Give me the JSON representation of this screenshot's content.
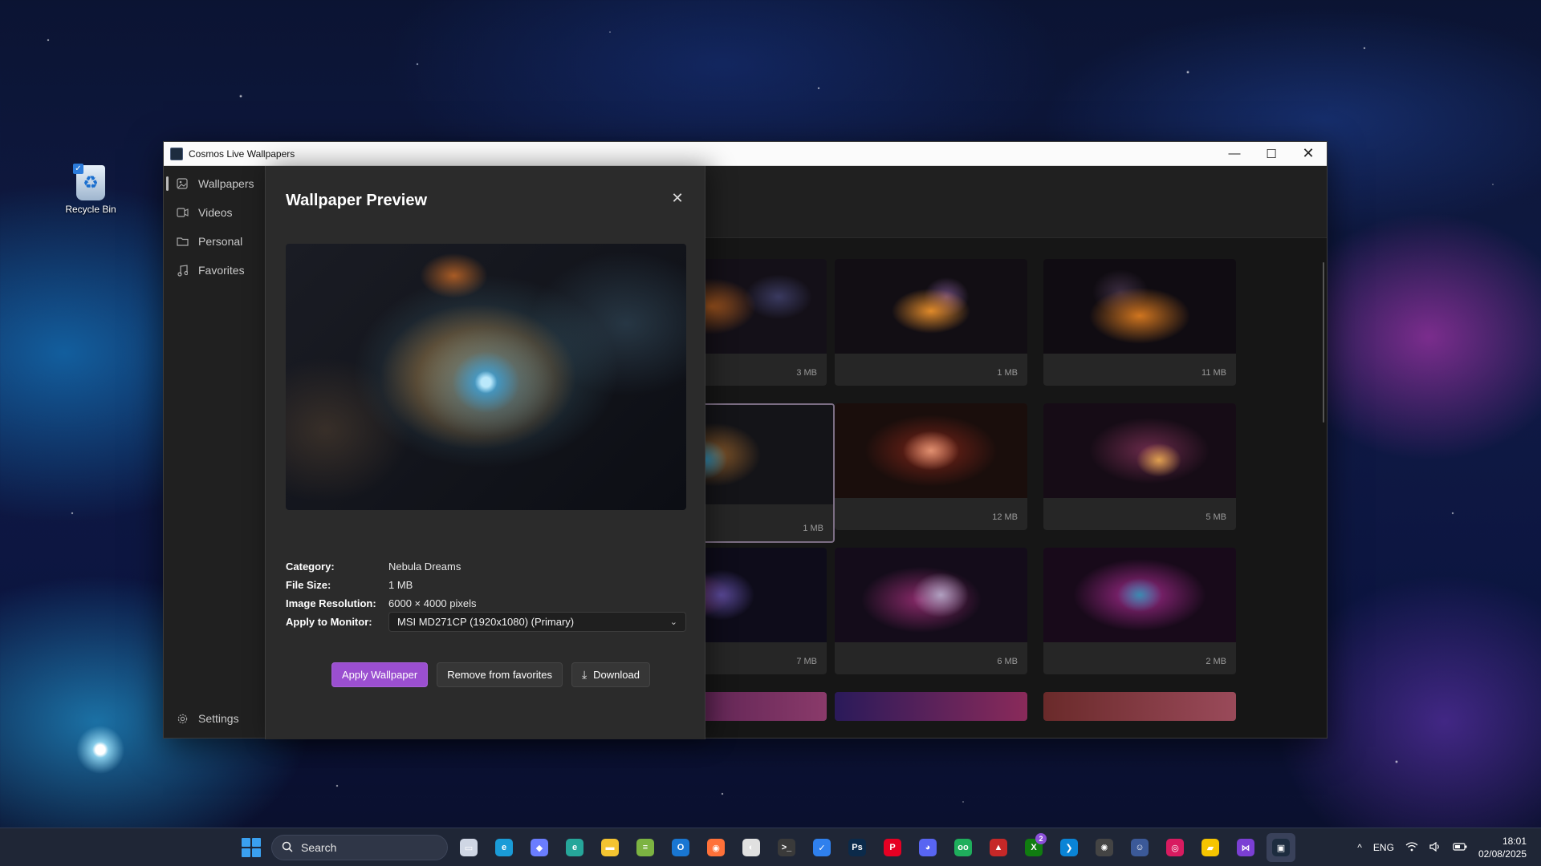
{
  "desktop": {
    "icons": [
      {
        "label": "Recycle Bin"
      }
    ]
  },
  "window": {
    "title": "Cosmos Live Wallpapers",
    "controls": {
      "minimize": "—",
      "maximize": "☐",
      "close": "✕"
    }
  },
  "nav": {
    "items": [
      {
        "label": "Wallpapers",
        "icon": "image-icon",
        "active": true
      },
      {
        "label": "Videos",
        "icon": "video-icon"
      },
      {
        "label": "Personal",
        "icon": "folder-icon"
      },
      {
        "label": "Favorites",
        "icon": "music-note-icon"
      }
    ],
    "settings": {
      "label": "Settings",
      "icon": "gear-icon"
    }
  },
  "grid": {
    "cards": [
      {
        "size": "3 MB"
      },
      {
        "size": "1 MB"
      },
      {
        "size": "11 MB"
      },
      {
        "size": "1 MB",
        "selected": true
      },
      {
        "size": "12 MB"
      },
      {
        "size": "5 MB"
      },
      {
        "size": "7 MB"
      },
      {
        "size": "6 MB"
      },
      {
        "size": "2 MB"
      },
      {
        "size": ""
      },
      {
        "size": ""
      },
      {
        "size": ""
      }
    ]
  },
  "dialog": {
    "title": "Wallpaper Preview",
    "close_icon": "close-icon",
    "details": {
      "category_label": "Category:",
      "category_value": "Nebula Dreams",
      "file_size_label": "File Size:",
      "file_size_value": "1 MB",
      "resolution_label": "Image Resolution:",
      "resolution_value": "6000 × 4000 pixels",
      "monitor_label": "Apply to Monitor:",
      "monitor_value": "MSI MD271CP (1920x1080) (Primary)"
    },
    "buttons": {
      "apply": "Apply Wallpaper",
      "remove_favorite": "Remove from favorites",
      "download": "Download"
    }
  },
  "taskbar": {
    "search_placeholder": "Search",
    "pinned": [
      {
        "name": "task-view",
        "glyph": "▭",
        "color": "#cfd6e4"
      },
      {
        "name": "edge",
        "glyph": "e",
        "color": "#1a9bd7"
      },
      {
        "name": "copilot",
        "glyph": "◆",
        "color": "#6a7dff"
      },
      {
        "name": "edge-beta",
        "glyph": "e",
        "color": "#26a69a"
      },
      {
        "name": "file-explorer",
        "glyph": "▬",
        "color": "#f4c431"
      },
      {
        "name": "notepad",
        "glyph": "≡",
        "color": "#7cb342"
      },
      {
        "name": "outlook",
        "glyph": "O",
        "color": "#1976d2"
      },
      {
        "name": "firefox",
        "glyph": "◉",
        "color": "#ff7139"
      },
      {
        "name": "app",
        "glyph": "◐",
        "color": "#e0e0e0"
      },
      {
        "name": "terminal",
        "glyph": ">_",
        "color": "#3a3a3a"
      },
      {
        "name": "todo",
        "glyph": "✓",
        "color": "#2f80ed"
      },
      {
        "name": "photoshop",
        "glyph": "Ps",
        "color": "#0b2a4a"
      },
      {
        "name": "pinterest",
        "glyph": "P",
        "color": "#e60023"
      },
      {
        "name": "discord",
        "glyph": "◕",
        "color": "#5865f2"
      },
      {
        "name": "app-green",
        "glyph": "oo",
        "color": "#1fae5c"
      },
      {
        "name": "app-red",
        "glyph": "▲",
        "color": "#c62828"
      },
      {
        "name": "xbox",
        "glyph": "X",
        "color": "#107c10",
        "badge": "2"
      },
      {
        "name": "vscode",
        "glyph": "❯",
        "color": "#0a84d6"
      },
      {
        "name": "chatgpt",
        "glyph": "✺",
        "color": "#444"
      },
      {
        "name": "app-blue",
        "glyph": "☺",
        "color": "#3b5998"
      },
      {
        "name": "app-pink",
        "glyph": "◎",
        "color": "#d81b60"
      },
      {
        "name": "sticky-notes",
        "glyph": "▰",
        "color": "#f5c400"
      },
      {
        "name": "visual-studio",
        "glyph": "⋈",
        "color": "#7b3fd4"
      },
      {
        "name": "cosmos-app",
        "glyph": "▣",
        "color": "#1d2c3f",
        "active": true
      }
    ],
    "tray": {
      "chevron": "^",
      "lang": "ENG",
      "wifi_icon": "wifi-icon",
      "volume_icon": "volume-icon",
      "battery_icon": "battery-icon",
      "time": "18:01",
      "date": "02/08/2025"
    }
  },
  "colors": {
    "accent": "#9b4fd0",
    "dialog_bg": "#2b2b2b",
    "window_bg": "#1c1c1c"
  }
}
